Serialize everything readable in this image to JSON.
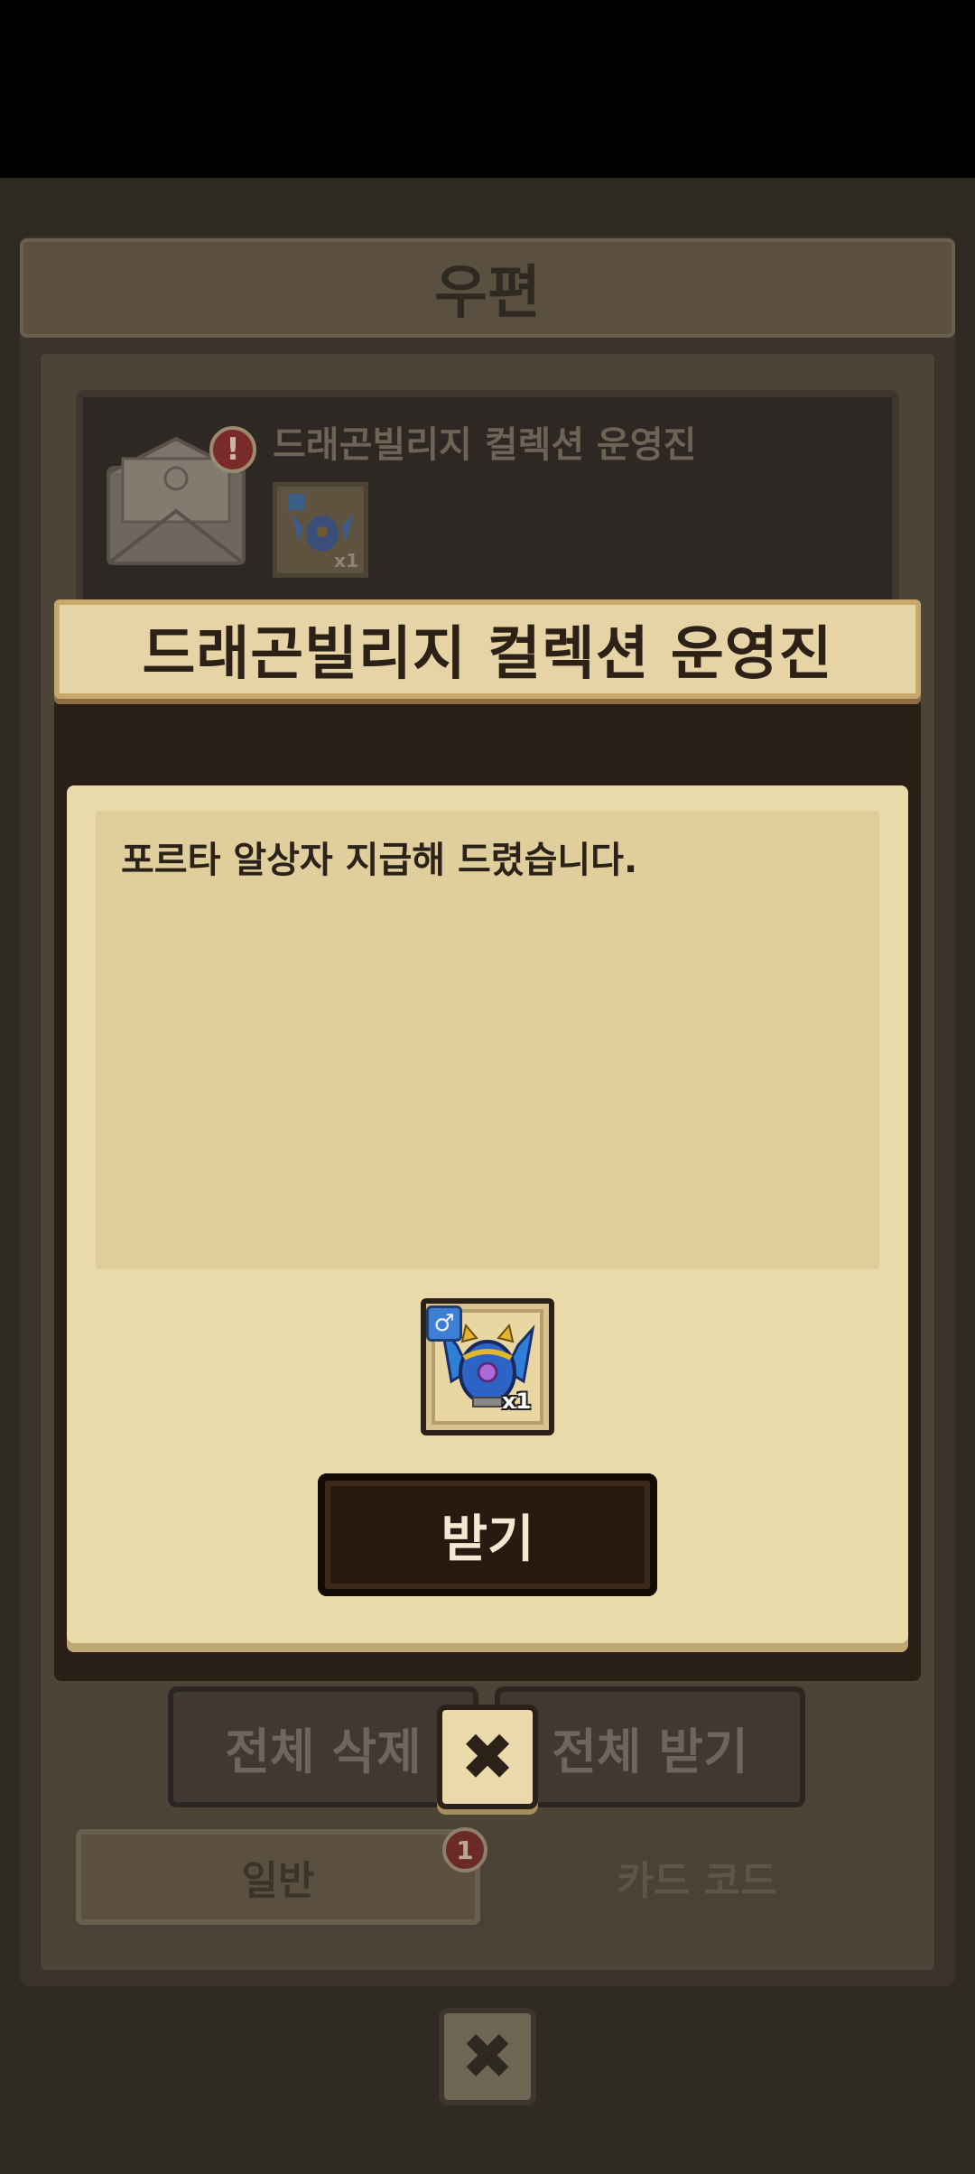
{
  "window": {
    "title": "우편"
  },
  "mail_list": {
    "items": [
      {
        "sender": "드래곤빌리지 컬렉션 운영진",
        "attachment_qty": "x1",
        "alert_icon": "exclamation-icon"
      }
    ]
  },
  "actions": {
    "delete_all": "전체 삭제",
    "receive_all": "전체 받기"
  },
  "tabs": {
    "general": "일반",
    "card_code": "카드 코드",
    "general_badge": "1"
  },
  "modal": {
    "title": "드래곤빌리지 컬렉션 운영진",
    "message": "포르타 알상자 지급해 드렸습니다.",
    "reward_qty": "x1",
    "claim_button": "받기"
  },
  "colors": {
    "accent_blue": "#3d7fd3",
    "modal_bg": "#e8daa9",
    "frame_dark": "#2a1f16"
  }
}
